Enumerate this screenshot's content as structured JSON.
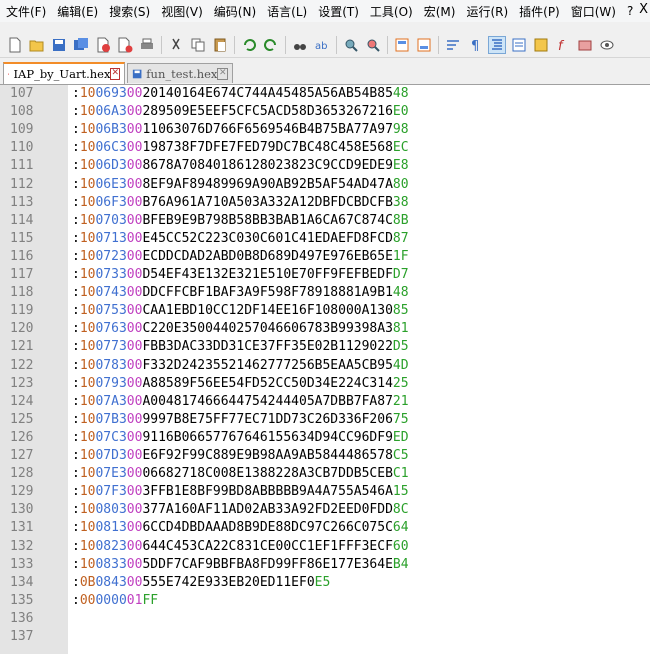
{
  "menu": [
    "文件(F)",
    "编辑(E)",
    "搜索(S)",
    "视图(V)",
    "编码(N)",
    "语言(L)",
    "设置(T)",
    "工具(O)",
    "宏(M)",
    "运行(R)",
    "插件(P)",
    "窗口(W)",
    "?"
  ],
  "window_close": "X",
  "tabs": [
    {
      "label": "IAP_by_Uart.hex",
      "active": true
    },
    {
      "label": "fun_test.hex",
      "active": false
    }
  ],
  "lines": [
    {
      "num": "107",
      "len": "10",
      "addr": "0693",
      "type": "00",
      "data": "20140164E674C744A45485A56AB54B85",
      "sum": "48"
    },
    {
      "num": "108",
      "len": "10",
      "addr": "06A3",
      "type": "00",
      "data": "289509E5EEF5CFC5ACD58D3653267216",
      "sum": "E0"
    },
    {
      "num": "109",
      "len": "10",
      "addr": "06B3",
      "type": "00",
      "data": "11063076D766F6569546B4B75BA77A97",
      "sum": "98"
    },
    {
      "num": "110",
      "len": "10",
      "addr": "06C3",
      "type": "00",
      "data": "198738F7DFE7FED79DC7BC48C458E568",
      "sum": "EC"
    },
    {
      "num": "111",
      "len": "10",
      "addr": "06D3",
      "type": "00",
      "data": "8678A708401861280238 23C9CCD9EDE9",
      "sum": "E8"
    },
    {
      "num": "112",
      "len": "10",
      "addr": "06E3",
      "type": "00",
      "data": "8EF9AF89489969A90AB92B5AF54AD47A",
      "sum": "80"
    },
    {
      "num": "113",
      "len": "10",
      "addr": "06F3",
      "type": "00",
      "data": "B76A961A710A503A332A12DBFDCBDCFB",
      "sum": "38"
    },
    {
      "num": "114",
      "len": "10",
      "addr": "0703",
      "type": "00",
      "data": "BFEB9E9B798B58BB3BAB1A6CA67C874C",
      "sum": "8B"
    },
    {
      "num": "115",
      "len": "10",
      "addr": "0713",
      "type": "00",
      "data": "E45CC52C223C030C601C41EDAEFD8FCD",
      "sum": "87"
    },
    {
      "num": "116",
      "len": "10",
      "addr": "0723",
      "type": "00",
      "data": "ECDDCDAD2ABD0B8D689D497E976EB65E",
      "sum": "1F"
    },
    {
      "num": "117",
      "len": "10",
      "addr": "0733",
      "type": "00",
      "data": "D54EF43E132E321E510E70FF9FEFBEDF",
      "sum": "D7"
    },
    {
      "num": "118",
      "len": "10",
      "addr": "0743",
      "type": "00",
      "data": "DDCFFCBF1BAF3A9F598F78918881A9B1",
      "sum": "48"
    },
    {
      "num": "119",
      "len": "10",
      "addr": "0753",
      "type": "00",
      "data": "CAA1EBD10CC12DF14EE16F108000A130",
      "sum": "85"
    },
    {
      "num": "120",
      "len": "10",
      "addr": "0763",
      "type": "00",
      "data": "C220E35004402570466067 83B99398A3",
      "sum": "81"
    },
    {
      "num": "121",
      "len": "10",
      "addr": "0773",
      "type": "00",
      "data": "FBB3DAC33DD31CE37FF35E02B1129022",
      "sum": "D5"
    },
    {
      "num": "122",
      "len": "10",
      "addr": "0783",
      "type": "00",
      "data": "F332D242355214627772 56B5EAA5CB95",
      "sum": "4D"
    },
    {
      "num": "123",
      "len": "10",
      "addr": "0793",
      "type": "00",
      "data": "A88589F56EE54FD52CC50D34E224C314",
      "sum": "25"
    },
    {
      "num": "124",
      "len": "10",
      "addr": "07A3",
      "type": "00",
      "data": "A004817466644754244405A7DBB7FA87",
      "sum": "21"
    },
    {
      "num": "125",
      "len": "10",
      "addr": "07B3",
      "type": "00",
      "data": "9997B8E75FF77EC71DD73C26D336F206",
      "sum": "75"
    },
    {
      "num": "126",
      "len": "10",
      "addr": "07C3",
      "type": "00",
      "data": "9116B066577676461556 34D94CC96DF9",
      "sum": "ED"
    },
    {
      "num": "127",
      "len": "10",
      "addr": "07D3",
      "type": "00",
      "data": "E6F92F99C889E9B98AA9AB5844486578",
      "sum": "C5"
    },
    {
      "num": "128",
      "len": "10",
      "addr": "07E3",
      "type": "00",
      "data": "06682718C008E1388228A3CB7DDB5CEB",
      "sum": "C1"
    },
    {
      "num": "129",
      "len": "10",
      "addr": "07F3",
      "type": "00",
      "data": "3FFB1E8BF99BD8ABBBBB9A4A755A546A",
      "sum": "15"
    },
    {
      "num": "130",
      "len": "10",
      "addr": "0803",
      "type": "00",
      "data": "377A160AF11AD02AB33A92FD2EED0FDD",
      "sum": "8C"
    },
    {
      "num": "131",
      "len": "10",
      "addr": "0813",
      "type": "00",
      "data": "6CCD4DBDAAAD8B9DE88DC97C266C075C",
      "sum": "64"
    },
    {
      "num": "132",
      "len": "10",
      "addr": "0823",
      "type": "00",
      "data": "644C453CA22C831CE00CC1EF1FFF3ECF",
      "sum": "60"
    },
    {
      "num": "133",
      "len": "10",
      "addr": "0833",
      "type": "00",
      "data": "5DDF7CAF9BBFBA8FD99FF86E177E364E",
      "sum": "B4"
    },
    {
      "num": "134",
      "len": "0B",
      "addr": "0843",
      "type": "00",
      "data": "555E742E933EB20ED11EF0",
      "sum": "E5"
    },
    {
      "num": "135",
      "len": "00",
      "addr": "0000",
      "type": "01",
      "data": "",
      "sum": "FF"
    },
    {
      "num": "136",
      "len": "",
      "addr": "",
      "type": "",
      "data": "",
      "sum": ""
    },
    {
      "num": "137",
      "len": "",
      "addr": "",
      "type": "",
      "data": "",
      "sum": ""
    }
  ],
  "colors": {
    "length": "#c06020",
    "address": "#4070d0",
    "type": "#c040c0",
    "checksum": "#2aa02a",
    "tab_accent": "#f28c28"
  }
}
